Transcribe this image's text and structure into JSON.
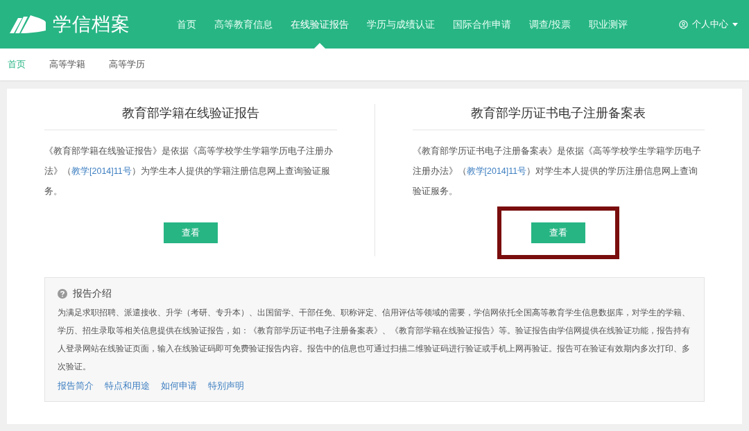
{
  "header": {
    "logo": "学信档案",
    "nav": [
      {
        "label": "首页",
        "selected": false
      },
      {
        "label": "高等教育信息",
        "selected": false
      },
      {
        "label": "在线验证报告",
        "selected": true
      },
      {
        "label": "学历与成绩认证",
        "selected": false
      },
      {
        "label": "国际合作申请",
        "selected": false
      },
      {
        "label": "调查/投票",
        "selected": false
      },
      {
        "label": "职业测评",
        "selected": false
      }
    ],
    "user_menu": "个人中心"
  },
  "breadcrumb": [
    {
      "label": "首页",
      "selected": true
    },
    {
      "label": "高等学籍",
      "selected": false
    },
    {
      "label": "高等学历",
      "selected": false
    }
  ],
  "cards": [
    {
      "title": "教育部学籍在线验证报告",
      "text_before": "《教育部学籍在线验证报告》是依据《高等学校学生学籍学历电子注册办法》（",
      "link": "教学[2014]11号",
      "text_after": "）为学生本人提供的学籍注册信息网上查询验证服务。",
      "button": "查看",
      "highlighted": false
    },
    {
      "title": "教育部学历证书电子注册备案表",
      "text_before": "《教育部学历证书电子注册备案表》是依据《高等学校学生学籍学历电子注册办法》（",
      "link": "教学[2014]11号",
      "text_after": "）对学生本人提供的学历注册信息网上查询验证服务。",
      "button": "查看",
      "highlighted": true
    }
  ],
  "intro": {
    "title": "报告介绍",
    "text": "为满足求职招聘、派遣接收、升学（考研、专升本）、出国留学、干部任免、职称评定、信用评估等领域的需要，学信网依托全国高等教育学生信息数据库，对学生的学籍、学历、招生录取等相关信息提供在线验证报告，如：《教育部学历证书电子注册备案表》、《教育部学籍在线验证报告》等。验证报告由学信网提供在线验证功能，报告持有人登录网站在线验证页面，输入在线验证码即可免费验证报告内容。报告中的信息也可通过扫描二维验证码进行验证或手机上网再验证。报告可在验证有效期内多次打印、多次验证。",
    "links": [
      "报告简介",
      "特点和用途",
      "如何申请",
      "特别声明"
    ]
  }
}
